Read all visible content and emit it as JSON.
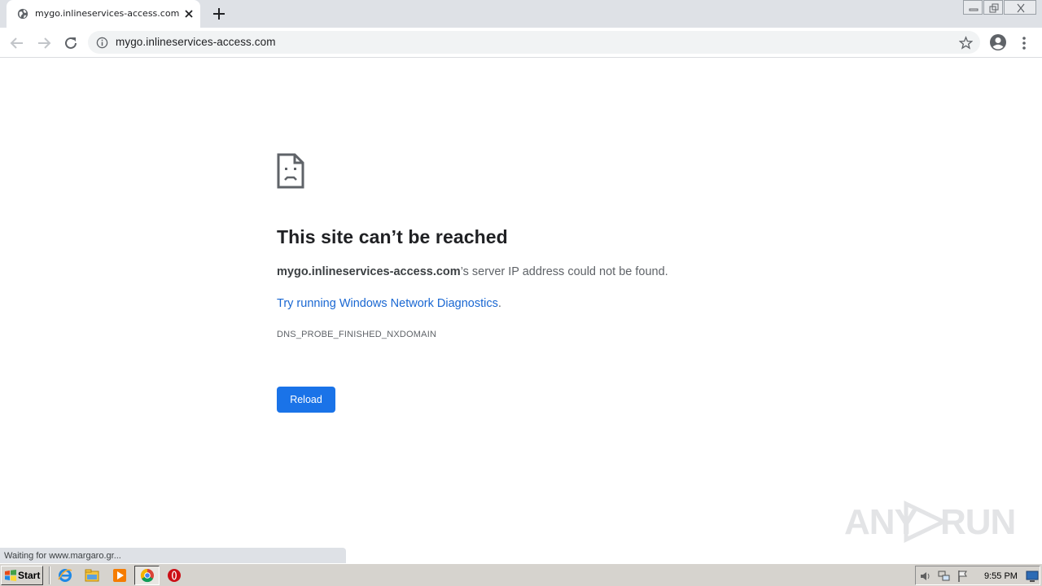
{
  "browser": {
    "tab": {
      "title": "mygo.inlineservices-access.com",
      "favicon": "globe-icon",
      "close_icon": "close-icon"
    },
    "new_tab_icon": "plus-icon",
    "window_controls": [
      "minimize-icon",
      "restore-icon",
      "close-icon"
    ],
    "omnibox": {
      "url": "mygo.inlineservices-access.com",
      "info_icon": "info-icon",
      "bookmark_icon": "star-icon"
    },
    "nav": [
      "back-arrow-icon",
      "forward-arrow-icon",
      "reload-icon"
    ],
    "profile_icon": "account-circle-icon",
    "menu_icon": "vertical-dots-icon"
  },
  "error_page": {
    "icon": "sad-document-icon",
    "title": "This site can’t be reached",
    "host": "mygo.inlineservices-access.com",
    "message_suffix": "’s server IP address could not be found.",
    "link_text": "Try running Windows Network Diagnostics",
    "link_period": ".",
    "error_code": "DNS_PROBE_FINISHED_NXDOMAIN",
    "reload_label": "Reload",
    "accent_color": "#1a73e8"
  },
  "status_bar": {
    "text": "Waiting for www.margaro.gr..."
  },
  "watermark": {
    "left": "ANY",
    "right": "RUN"
  },
  "taskbar": {
    "start_label": "Start",
    "pinned_icons": [
      "internet-explorer-icon",
      "file-explorer-icon",
      "media-player-icon",
      "chrome-icon",
      "opera-icon"
    ],
    "tray_icons": [
      "volume-icon",
      "network-icon",
      "flag-icon",
      "display-icon"
    ],
    "clock": "9:55 PM"
  }
}
